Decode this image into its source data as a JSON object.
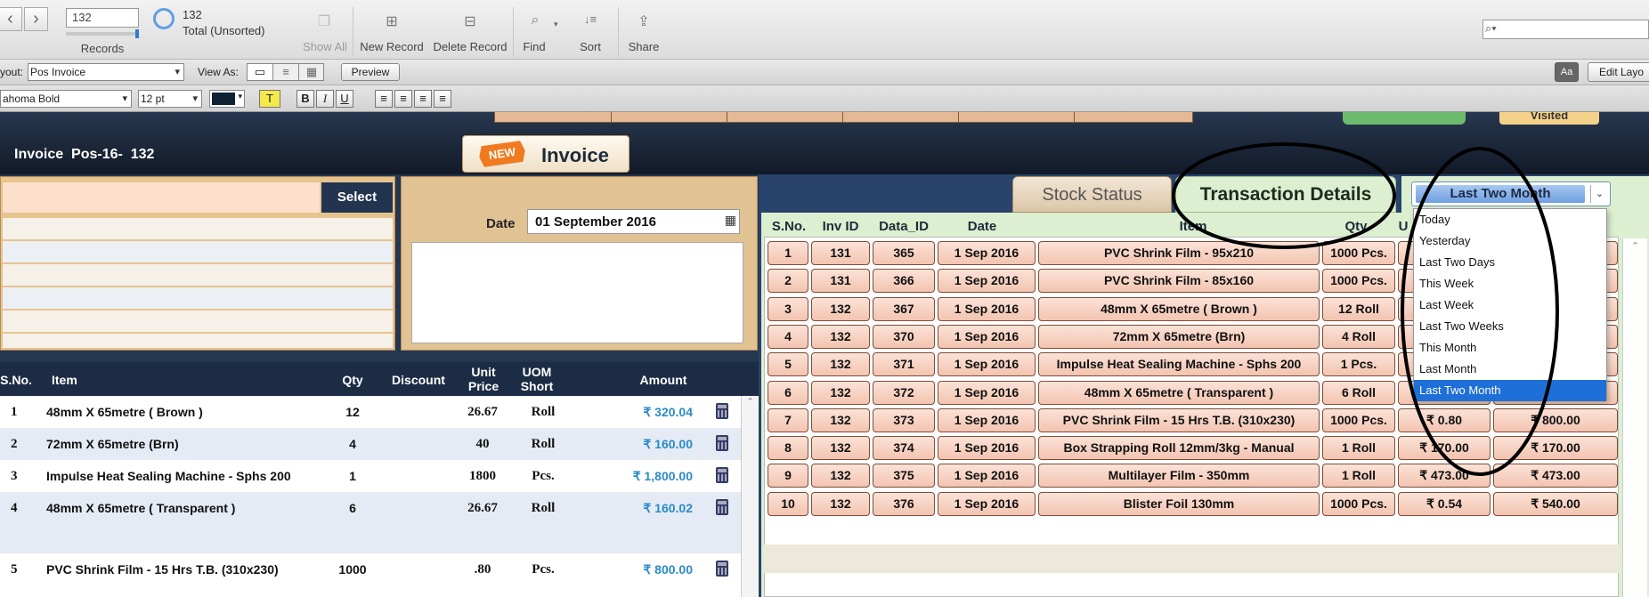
{
  "toolbar": {
    "record_number": "132",
    "records_label": "Records",
    "found_count": "132",
    "found_status": "Total (Unsorted)",
    "show_all": "Show All",
    "new_record": "New Record",
    "delete_record": "Delete Record",
    "find": "Find",
    "sort": "Sort",
    "share": "Share"
  },
  "layoutbar": {
    "layout_label": "yout:",
    "layout_value": "Pos Invoice",
    "view_as_label": "View As:",
    "preview": "Preview",
    "edit_layout": "Edit Layo"
  },
  "formatbar": {
    "font": "ahoma Bold",
    "size": "12 pt",
    "bold": "B",
    "italic": "I",
    "underline": "U",
    "highlight": "T"
  },
  "header": {
    "title": "Invoice  Pos-16-  132",
    "badge": "NEW",
    "invoice_button": "Invoice",
    "visited": "Visited"
  },
  "customer": {
    "select_button": "Select"
  },
  "datebox": {
    "label": "Date",
    "value": "01 September 2016"
  },
  "left_table": {
    "headers": [
      "S.No.",
      "Item",
      "Qty",
      "Discount",
      "Unit Price",
      "UOM Short",
      "Amount"
    ],
    "rows": [
      {
        "sno": "1",
        "item": "48mm X 65metre ( Brown )",
        "qty": "12",
        "price": "26.67",
        "uom": "Roll",
        "amount": "₹ 320.04"
      },
      {
        "sno": "2",
        "item": "72mm X 65metre (Brn)",
        "qty": "4",
        "price": "40",
        "uom": "Roll",
        "amount": "₹ 160.00"
      },
      {
        "sno": "3",
        "item": "Impulse Heat Sealing Machine - Sphs 200",
        "qty": "1",
        "price": "1800",
        "uom": "Pcs.",
        "amount": "₹ 1,800.00"
      },
      {
        "sno": "4",
        "item": "48mm X 65metre ( Transparent )",
        "qty": "6",
        "price": "26.67",
        "uom": "Roll",
        "amount": "₹ 160.02"
      },
      {
        "sno": "5",
        "item": "PVC Shrink Film - 15 Hrs T.B. (310x230)",
        "qty": "1000",
        "price": ".80",
        "uom": "Pcs.",
        "amount": "₹ 800.00"
      }
    ]
  },
  "tabs": {
    "stock_status": "Stock Status",
    "transaction_details": "Transaction Details"
  },
  "period": {
    "selected": "Last Two Month",
    "options": [
      "Today",
      "Yesterday",
      "Last Two Days",
      "This Week",
      "Last Week",
      "Last Two Weeks",
      "This Month",
      "Last Month",
      "Last Two Month"
    ]
  },
  "transactions": {
    "headers": [
      "S.No.",
      "Inv ID",
      "Data_ID",
      "Date",
      "Item",
      "Qty",
      "U"
    ],
    "rows": [
      {
        "sno": "1",
        "inv": "131",
        "did": "365",
        "date": "1 Sep 2016",
        "item": "PVC Shrink Film - 95x210",
        "qty": "1000 Pcs.",
        "rate": "",
        "amount": ""
      },
      {
        "sno": "2",
        "inv": "131",
        "did": "366",
        "date": "1 Sep 2016",
        "item": "PVC Shrink Film - 85x160",
        "qty": "1000 Pcs.",
        "rate": "",
        "amount": ""
      },
      {
        "sno": "3",
        "inv": "132",
        "did": "367",
        "date": "1 Sep 2016",
        "item": "48mm X 65metre ( Brown )",
        "qty": "12 Roll",
        "rate": "",
        "amount": ""
      },
      {
        "sno": "4",
        "inv": "132",
        "did": "370",
        "date": "1 Sep 2016",
        "item": "72mm X 65metre (Brn)",
        "qty": "4 Roll",
        "rate": "",
        "amount": ""
      },
      {
        "sno": "5",
        "inv": "132",
        "did": "371",
        "date": "1 Sep 2016",
        "item": "Impulse Heat Sealing Machine - Sphs 200",
        "qty": "1 Pcs.",
        "rate": "",
        "amount": ""
      },
      {
        "sno": "6",
        "inv": "132",
        "did": "372",
        "date": "1 Sep 2016",
        "item": "48mm X 65metre ( Transparent )",
        "qty": "6 Roll",
        "rate": "",
        "amount": ""
      },
      {
        "sno": "7",
        "inv": "132",
        "did": "373",
        "date": "1 Sep 2016",
        "item": "PVC Shrink Film - 15 Hrs T.B. (310x230)",
        "qty": "1000 Pcs.",
        "rate": "₹ 0.80",
        "amount": "₹ 800.00"
      },
      {
        "sno": "8",
        "inv": "132",
        "did": "374",
        "date": "1 Sep 2016",
        "item": "Box Strapping Roll 12mm/3kg - Manual",
        "qty": "1 Roll",
        "rate": "₹ 170.00",
        "amount": "₹ 170.00"
      },
      {
        "sno": "9",
        "inv": "132",
        "did": "375",
        "date": "1 Sep 2016",
        "item": "Multilayer Film - 350mm",
        "qty": "1 Roll",
        "rate": "₹ 473.00",
        "amount": "₹ 473.00"
      },
      {
        "sno": "10",
        "inv": "132",
        "did": "376",
        "date": "1 Sep 2016",
        "item": "Blister Foil 130mm",
        "qty": "1000 Pcs.",
        "rate": "₹ 0.54",
        "amount": "₹ 540.00"
      }
    ]
  },
  "colors": {
    "header_bg": "#1b2638",
    "cell_fill": "#f7d0c0",
    "amount_blue": "#2b8bc8",
    "dropdown_highlight": "#1f6fd8"
  }
}
